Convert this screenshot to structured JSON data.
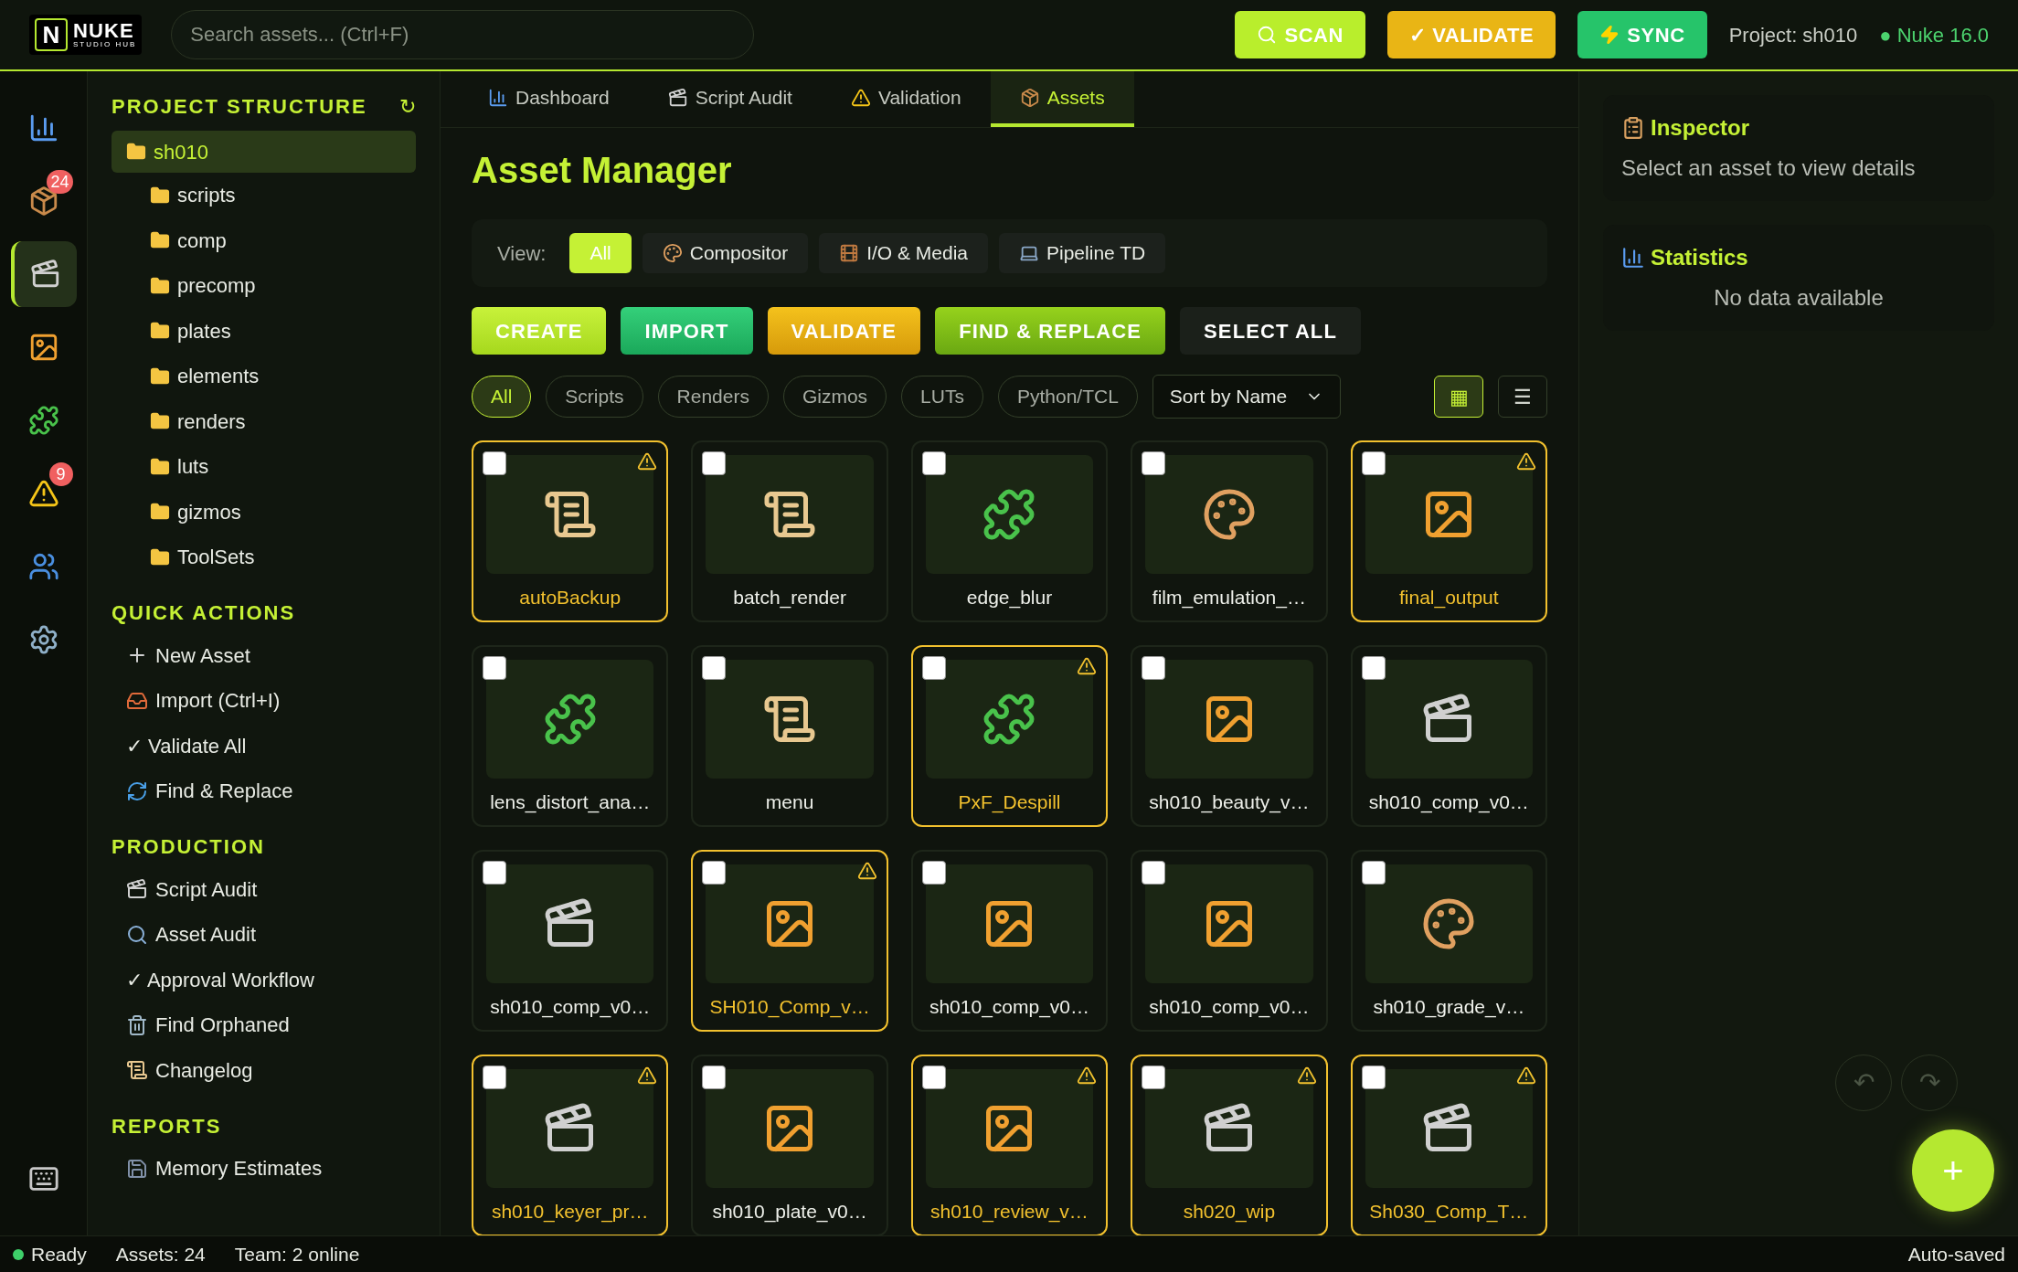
{
  "logo": {
    "letter": "N",
    "name": "NUKE",
    "subtitle": "STUDIO HUB"
  },
  "search": {
    "placeholder": "Search assets... (Ctrl+F)"
  },
  "top_actions": [
    {
      "kind": "scan",
      "label": "SCAN"
    },
    {
      "kind": "validate",
      "label": "✓ VALIDATE"
    },
    {
      "kind": "sync",
      "label": "SYNC"
    }
  ],
  "project_label": "Project: sh010",
  "version": {
    "label": "● Nuke 16.0"
  },
  "rail": [
    {
      "kind": "chart",
      "selected": false
    },
    {
      "kind": "package",
      "selected": false,
      "badge": "24"
    },
    {
      "kind": "clapper",
      "selected": true
    },
    {
      "kind": "image",
      "selected": false
    },
    {
      "kind": "puzzle",
      "selected": false
    },
    {
      "kind": "warning",
      "selected": false,
      "badge": "9"
    },
    {
      "kind": "users",
      "selected": false
    },
    {
      "kind": "settings",
      "selected": false
    },
    {
      "kind": "keyboard",
      "selected": false
    }
  ],
  "project_structure": {
    "title": "PROJECT STRUCTURE",
    "refresh": "↻",
    "root": {
      "label": "sh010",
      "selected": true,
      "children": [
        {
          "label": "scripts"
        },
        {
          "label": "comp"
        },
        {
          "label": "precomp"
        },
        {
          "label": "plates"
        },
        {
          "label": "elements"
        },
        {
          "label": "renders"
        },
        {
          "label": "luts"
        },
        {
          "label": "gizmos"
        },
        {
          "label": "ToolSets"
        }
      ]
    }
  },
  "sections": [
    {
      "title": "QUICK ACTIONS",
      "items": [
        {
          "kind": "plus",
          "label": "New Asset"
        },
        {
          "kind": "inbox",
          "label": "Import (Ctrl+I)"
        },
        {
          "kind": "none",
          "label": "✓ Validate All"
        },
        {
          "kind": "refresh",
          "label": "Find & Replace"
        }
      ]
    },
    {
      "title": "PRODUCTION",
      "items": [
        {
          "kind": "clapper",
          "label": "Script Audit"
        },
        {
          "kind": "search",
          "label": "Asset Audit"
        },
        {
          "kind": "none",
          "label": "✓ Approval Workflow"
        },
        {
          "kind": "trash",
          "label": "Find Orphaned"
        },
        {
          "kind": "scroll",
          "label": "Changelog"
        }
      ]
    },
    {
      "title": "REPORTS",
      "items": [
        {
          "kind": "disk",
          "label": "Memory Estimates"
        }
      ]
    }
  ],
  "tabs": [
    {
      "kind": "chart",
      "label": "Dashboard",
      "selected": false
    },
    {
      "kind": "clapper",
      "label": "Script Audit",
      "selected": false
    },
    {
      "kind": "warning",
      "label": "Validation",
      "selected": false
    },
    {
      "kind": "package",
      "label": "Assets",
      "selected": true
    }
  ],
  "title": "Asset Manager",
  "view": {
    "label": "View:",
    "options": [
      {
        "kind": "none",
        "label": "All",
        "selected": true
      },
      {
        "kind": "palette",
        "label": "Compositor",
        "selected": false
      },
      {
        "kind": "film",
        "label": "I/O & Media",
        "selected": false
      },
      {
        "kind": "laptop",
        "label": "Pipeline TD",
        "selected": false
      }
    ]
  },
  "actions": [
    {
      "kind": "lime",
      "label": "CREATE"
    },
    {
      "kind": "green",
      "label": "IMPORT"
    },
    {
      "kind": "amber",
      "label": "VALIDATE"
    },
    {
      "kind": "olive",
      "label": "FIND & REPLACE"
    },
    {
      "kind": "dark",
      "label": "SELECT ALL"
    }
  ],
  "filters": [
    {
      "label": "All",
      "selected": true
    },
    {
      "label": "Scripts",
      "selected": false
    },
    {
      "label": "Renders",
      "selected": false
    },
    {
      "label": "Gizmos",
      "selected": false
    },
    {
      "label": "LUTs",
      "selected": false
    },
    {
      "label": "Python/TCL",
      "selected": false
    }
  ],
  "sort": {
    "value": "Sort by Name"
  },
  "layout_toggle": [
    {
      "label": "▦",
      "selected": true
    },
    {
      "label": "☰",
      "selected": false
    }
  ],
  "assets": [
    {
      "kind": "script",
      "name": "autoBackup",
      "warning": true,
      "checked": false
    },
    {
      "kind": "script",
      "name": "batch_render",
      "warning": false,
      "checked": false
    },
    {
      "kind": "gizmo",
      "name": "edge_blur",
      "warning": false,
      "checked": false
    },
    {
      "kind": "lut",
      "name": "film_emulation_…",
      "warning": false,
      "checked": false
    },
    {
      "kind": "image",
      "name": "final_output",
      "warning": true,
      "checked": false
    },
    {
      "kind": "gizmo",
      "name": "lens_distort_ana…",
      "warning": false,
      "checked": false
    },
    {
      "kind": "script",
      "name": "menu",
      "warning": false,
      "checked": false
    },
    {
      "kind": "gizmo",
      "name": "PxF_Despill",
      "warning": true,
      "checked": false
    },
    {
      "kind": "image",
      "name": "sh010_beauty_v…",
      "warning": false,
      "checked": false
    },
    {
      "kind": "comp",
      "name": "sh010_comp_v0…",
      "warning": false,
      "checked": false
    },
    {
      "kind": "comp",
      "name": "sh010_comp_v0…",
      "warning": false,
      "checked": false
    },
    {
      "kind": "image",
      "name": "SH010_Comp_v…",
      "warning": true,
      "checked": false
    },
    {
      "kind": "image",
      "name": "sh010_comp_v0…",
      "warning": false,
      "checked": false
    },
    {
      "kind": "image",
      "name": "sh010_comp_v0…",
      "warning": false,
      "checked": false
    },
    {
      "kind": "lut",
      "name": "sh010_grade_v…",
      "warning": false,
      "checked": false
    },
    {
      "kind": "comp",
      "name": "sh010_keyer_pr…",
      "warning": true,
      "checked": false
    },
    {
      "kind": "image",
      "name": "sh010_plate_v0…",
      "warning": false,
      "checked": false
    },
    {
      "kind": "image",
      "name": "sh010_review_v…",
      "warning": true,
      "checked": false
    },
    {
      "kind": "comp",
      "name": "sh020_wip",
      "warning": true,
      "checked": false
    },
    {
      "kind": "comp",
      "name": "Sh030_Comp_T…",
      "warning": true,
      "checked": false
    }
  ],
  "inspector": {
    "title": "Inspector",
    "text": "Select an asset to view details"
  },
  "statistics": {
    "title": "Statistics",
    "text": "No data available"
  },
  "history": [
    {
      "label": "↶"
    },
    {
      "label": "↷"
    }
  ],
  "fab": {
    "label": "+"
  },
  "status_bar": {
    "state": "Ready",
    "online": true,
    "assets": "Assets: 24",
    "team": "Team: 2 online",
    "saved": "Auto-saved"
  }
}
